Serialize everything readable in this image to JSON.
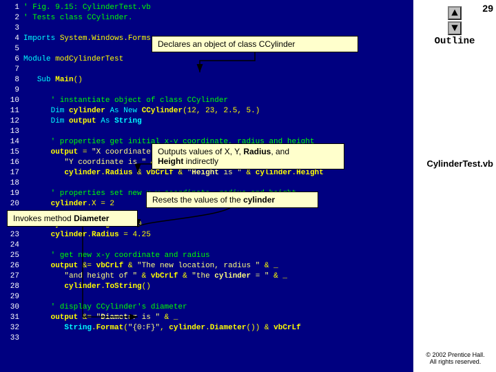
{
  "page": {
    "number": "29"
  },
  "outline": {
    "label": "Outline"
  },
  "cylinder_test_label": "CylinderTest.vb",
  "copyright": "© 2002 Prentice Hall.\nAll rights reserved.",
  "callouts": {
    "declares": "Declares an object of class CCylinder",
    "outputs": "Outputs values of X, Y, Radius, and\nHeight indirectly",
    "resets": "Resets the values of the cylinder",
    "invokes": "Invokes method Diameter"
  },
  "lines": [
    {
      "num": "1",
      "text": "' Fig. 9.15: CylinderTest.vb"
    },
    {
      "num": "2",
      "text": "' Tests class CCylinder."
    },
    {
      "num": "3",
      "text": ""
    },
    {
      "num": "4",
      "text": "Imports System.Windows.Forms"
    },
    {
      "num": "5",
      "text": ""
    },
    {
      "num": "6",
      "text": "Module modCylinderTest"
    },
    {
      "num": "7",
      "text": ""
    },
    {
      "num": "8",
      "text": "   Sub Main()"
    },
    {
      "num": "9",
      "text": ""
    },
    {
      "num": "10",
      "text": "      ' instantiate object of class CCylinder"
    },
    {
      "num": "11",
      "text": "      Dim cylinder As New CCylinder(12, 23, 2.5, 5.)"
    },
    {
      "num": "12",
      "text": "      Dim output As String"
    },
    {
      "num": "13",
      "text": ""
    },
    {
      "num": "14",
      "text": "      ' properties get initial x-y coordinate, radius and height"
    },
    {
      "num": "15",
      "text": "      output = \"X coordinate is \" & cylinder.X & vbCrLf & _"
    },
    {
      "num": "16",
      "text": "         \"Y coordinate is \" & cylinder.Y & vbCrLf & \"Radius is \" & _"
    },
    {
      "num": "17",
      "text": "         cylinder.Radius & vbCrLf & \"Height is \" & cylinder.Height"
    },
    {
      "num": "18",
      "text": ""
    },
    {
      "num": "19",
      "text": "      ' properties set new x-y coordinate, radius and height"
    },
    {
      "num": "20",
      "text": "      cylinder.X = 2"
    },
    {
      "num": "21",
      "text": "      cylinder.Y = 2"
    },
    {
      "num": "22",
      "text": "      cylinder.Height = 10"
    },
    {
      "num": "23",
      "text": "      cylinder.Radius = 4.25"
    },
    {
      "num": "24",
      "text": ""
    },
    {
      "num": "25",
      "text": "      ' get new x-y coordinate and radius"
    },
    {
      "num": "26",
      "text": "      output &= vbCrLf & \"The new location, radius \" & _"
    },
    {
      "num": "27",
      "text": "         \"and height of \" & vbCrLf & \"the cylinder = \" & _"
    },
    {
      "num": "28",
      "text": "         cylinder.ToString()"
    },
    {
      "num": "29",
      "text": ""
    },
    {
      "num": "30",
      "text": "      ' display CCylinder's diameter"
    },
    {
      "num": "31",
      "text": "      output &= \"Diameter is \" & _"
    },
    {
      "num": "32",
      "text": "         String.Format(\"{0:F}\", cylinder.Diameter()) & vbCrLf"
    },
    {
      "num": "33",
      "text": ""
    }
  ]
}
